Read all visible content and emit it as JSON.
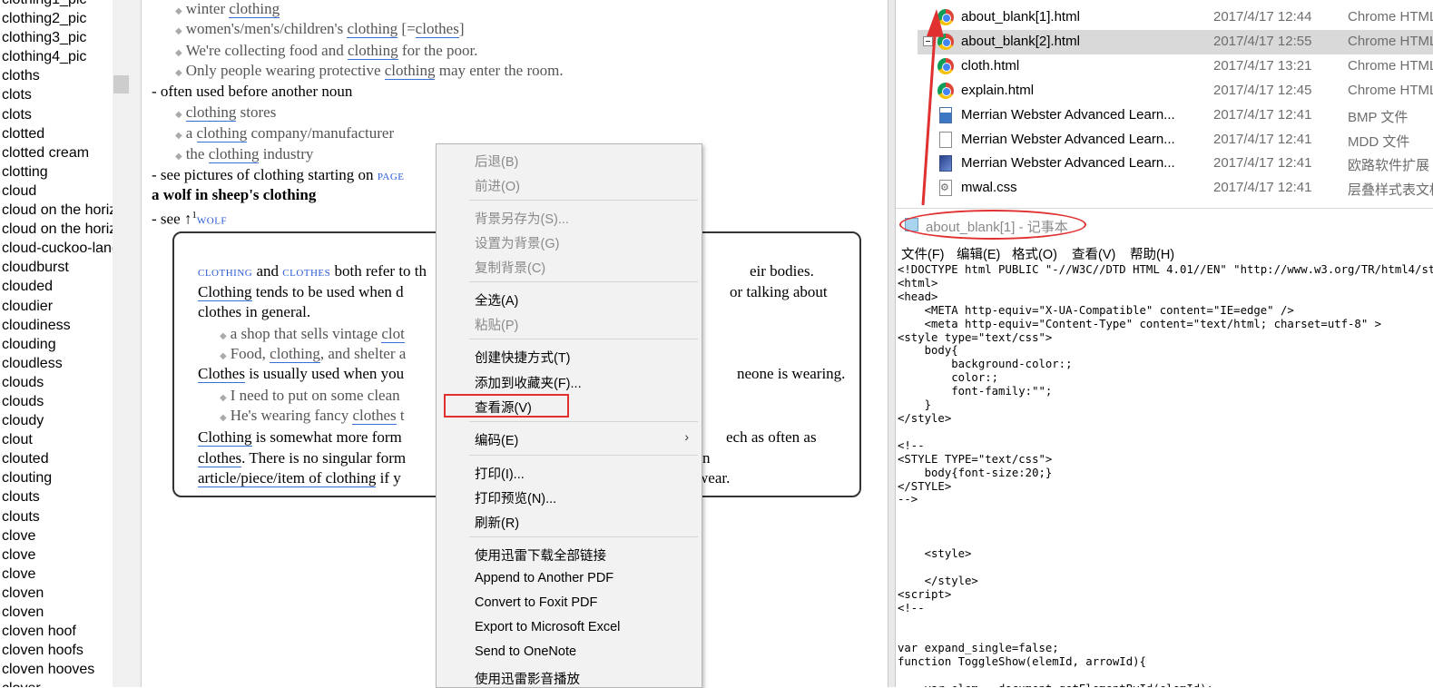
{
  "word_list": [
    "clothing1_pic",
    "clothing2_pic",
    "clothing3_pic",
    "clothing4_pic",
    "cloths",
    "clots",
    "clots",
    "clotted",
    "clotted cream",
    "clotting",
    "cloud",
    "cloud on the horizon",
    "cloud on the horizon",
    "cloud-cuckoo-land",
    "cloudburst",
    "clouded",
    "cloudier",
    "cloudiness",
    "clouding",
    "cloudless",
    "clouds",
    "clouds",
    "cloudy",
    "clout",
    "clouted",
    "clouting",
    "clouts",
    "clouts",
    "clove",
    "clove",
    "clove",
    "cloven",
    "cloven",
    "cloven hoof",
    "cloven hoofs",
    "cloven hooves",
    "clover"
  ],
  "dict": {
    "ex1": {
      "pre": "winter ",
      "kw": "clothing",
      "post": ""
    },
    "ex2": {
      "pre": "women's/men's/children's ",
      "kw": "clothing",
      "mid": " [=",
      "kw2": "clothes",
      "post": "]"
    },
    "ex3": {
      "pre": "We're collecting food and ",
      "kw": "clothing",
      "post": " for the poor."
    },
    "ex4": {
      "pre": "Only people wearing protective ",
      "kw": "clothing",
      "post": " may enter the room."
    },
    "note1": "- often used before another noun",
    "ex5": {
      "pre": "",
      "kw": "clothing",
      "post": " stores"
    },
    "ex6": {
      "pre": "a ",
      "kw": "clothing",
      "post": " company/manufacturer"
    },
    "ex7": {
      "pre": "the ",
      "kw": "clothing",
      "post": " industry"
    },
    "note2_pre": "- see pictures of clothing starting on ",
    "note2_link": "PAGE",
    "idiom": "a wolf in sheep's clothing",
    "note3_pre": "- see ↑",
    "note3_sup": "1",
    "note3_link": "WOLF",
    "box": {
      "l1_a": "CLOTHING",
      "l1_and": " and ",
      "l1_b": "CLOTHES",
      "l1_pre": " both refer to th",
      "l1_post": "eir bodies.",
      "l2_kw": "Clothing",
      "l2_pre": " tends to be used when d",
      "l2_post": "or talking about",
      "l3": "clothes in general.",
      "s1_pre": "a shop that sells vintage ",
      "s1_kw": "clot",
      "s2_pre": "Food, ",
      "s2_kw": "clothing",
      "s2_post": ", and shelter a",
      "l4_kw": "Clothes",
      "l4_pre": " is usually used when you",
      "l4_post": "neone is wearing.",
      "s3": "I need to put on some clean ",
      "s4_pre": "He's wearing fancy ",
      "s4_kw": "clothes",
      "s4_post": " t",
      "l5_kw": "Clothing",
      "l5_pre": " is somewhat more form",
      "l5_post": "ech as often as",
      "l6_kw": "clothes",
      "l6_pre": ". There is no singular form",
      "l6_post": "n",
      "l7_kw": "article/piece/item of clothing",
      "l7_pre": " if y",
      "l7_post": " wear."
    }
  },
  "context_menu": {
    "items": [
      {
        "label": "后退(B)",
        "disabled": true
      },
      {
        "label": "前进(O)",
        "disabled": true
      },
      {
        "label": "背景另存为(S)...",
        "disabled": true
      },
      {
        "label": "设置为背景(G)",
        "disabled": true
      },
      {
        "label": "复制背景(C)",
        "disabled": true
      },
      {
        "label": "全选(A)",
        "disabled": false
      },
      {
        "label": "粘贴(P)",
        "disabled": true
      },
      {
        "label": "创建快捷方式(T)",
        "disabled": false
      },
      {
        "label": "添加到收藏夹(F)...",
        "disabled": false
      },
      {
        "label": "查看源(V)",
        "disabled": false
      },
      {
        "label": "编码(E)",
        "disabled": false
      },
      {
        "label": "打印(I)...",
        "disabled": false
      },
      {
        "label": "打印预览(N)...",
        "disabled": false
      },
      {
        "label": "刷新(R)",
        "disabled": false
      },
      {
        "label": "使用迅雷下载全部链接",
        "disabled": false
      },
      {
        "label": "Append to Another PDF",
        "disabled": false
      },
      {
        "label": "Convert to Foxit PDF",
        "disabled": false
      },
      {
        "label": "Export to Microsoft Excel",
        "disabled": false
      },
      {
        "label": "Send to OneNote",
        "disabled": false
      },
      {
        "label": "使用迅雷影音播放",
        "disabled": false
      }
    ],
    "submenu_arrow": "›"
  },
  "files": [
    {
      "name": "about_blank[1].html",
      "date": "2017/4/17 12:44",
      "type": "Chrome HTML",
      "icon": "chrome-icon",
      "selected": false
    },
    {
      "name": "about_blank[2].html",
      "date": "2017/4/17 12:55",
      "type": "Chrome HTML",
      "icon": "chrome-icon",
      "selected": true
    },
    {
      "name": "cloth.html",
      "date": "2017/4/17 13:21",
      "type": "Chrome HTML",
      "icon": "chrome-icon",
      "selected": false
    },
    {
      "name": "explain.html",
      "date": "2017/4/17 12:45",
      "type": "Chrome HTML",
      "icon": "chrome-icon",
      "selected": false
    },
    {
      "name": "Merrian Webster Advanced Learn...",
      "date": "2017/4/17 12:41",
      "type": "BMP 文件",
      "icon": "bmp-file-icon",
      "selected": false
    },
    {
      "name": "Merrian Webster Advanced Learn...",
      "date": "2017/4/17 12:41",
      "type": "MDD 文件",
      "icon": "document-icon",
      "selected": false
    },
    {
      "name": "Merrian Webster Advanced Learn...",
      "date": "2017/4/17 12:41",
      "type": "欧路软件扩展",
      "icon": "app-file-icon",
      "selected": false
    },
    {
      "name": "mwal.css",
      "date": "2017/4/17 12:41",
      "type": "层叠样式表文档",
      "icon": "css-file-icon",
      "selected": false
    }
  ],
  "notepad": {
    "title": "about_blank[1] - 记事本",
    "menu": [
      "文件(F)",
      "编辑(E)",
      "格式(O)",
      "查看(V)",
      "帮助(H)"
    ],
    "text": "<!DOCTYPE html PUBLIC \"-//W3C//DTD HTML 4.01//EN\" \"http://www.w3.org/TR/html4/strict.dtd\">\n<html>\n<head>\n    <META http-equiv=\"X-UA-Compatible\" content=\"IE=edge\" />\n    <meta http-equiv=\"Content-Type\" content=\"text/html; charset=utf-8\" >\n<style type=\"text/css\">\n    body{\n        background-color:;\n        color:;\n        font-family:\"\";\n    }\n</style>\n\n<!--\n<STYLE TYPE=\"text/css\">\n    body{font-size:20;}\n</STYLE>\n-->\n\n\n\n    <style>\n\n    </style>\n<script>\n<!--\n\n\nvar expand_single=false;\nfunction ToggleShow(elemId, arrowId){\n\n    var elem = document.getElementById(elemId);"
  },
  "annotation_color": "#e03030"
}
